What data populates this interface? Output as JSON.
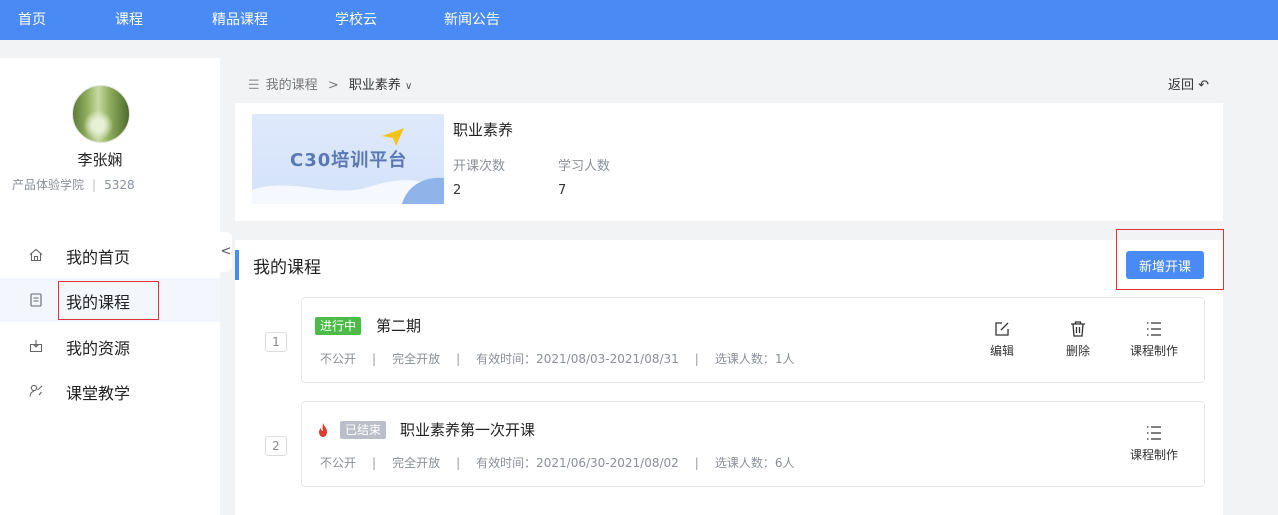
{
  "topnav": {
    "items": [
      {
        "label": "首页"
      },
      {
        "label": "课程"
      },
      {
        "label": "精品课程"
      },
      {
        "label": "学校云"
      },
      {
        "label": "新闻公告"
      }
    ]
  },
  "profile": {
    "name": "李张娴",
    "org": "产品体验学院",
    "id": "5328"
  },
  "sidebar": {
    "items": [
      {
        "label": "我的首页",
        "icon": "home-icon"
      },
      {
        "label": "我的课程",
        "icon": "course-icon",
        "active": true
      },
      {
        "label": "我的资源",
        "icon": "resource-icon"
      },
      {
        "label": "课堂教学",
        "icon": "teaching-icon"
      }
    ],
    "collapse_glyph": "<"
  },
  "breadcrumb": {
    "root": "我的课程",
    "separator": ">",
    "current": "职业素养"
  },
  "back": {
    "label": "返回"
  },
  "course": {
    "cover_text": "C30培训平台",
    "title": "职业素养",
    "sessions_label": "开课次数",
    "sessions_value": "2",
    "learners_label": "学习人数",
    "learners_value": "7"
  },
  "section": {
    "title": "我的课程",
    "new_button": "新增开课"
  },
  "sessions": [
    {
      "index": "1",
      "status": "进行中",
      "name": "第二期",
      "visibility": "不公开",
      "openness": "完全开放",
      "valid": "有效时间：2021/08/03-2021/08/31",
      "enrolled": "选课人数：1人",
      "actions": [
        {
          "label": "编辑",
          "icon": "edit-icon"
        },
        {
          "label": "删除",
          "icon": "trash-icon"
        },
        {
          "label": "课程制作",
          "icon": "list-icon"
        }
      ]
    },
    {
      "index": "2",
      "status": "已结束",
      "name": "职业素养第一次开课",
      "visibility": "不公开",
      "openness": "完全开放",
      "valid": "有效时间：2021/06/30-2021/08/02",
      "enrolled": "选课人数：6人",
      "actions": [
        {
          "label": "课程制作",
          "icon": "list-icon"
        }
      ]
    }
  ],
  "colors": {
    "primary": "#4a8af4",
    "active_badge": "#4cbb47",
    "ended_badge": "#b9bec8",
    "highlight_box": "#e1333b"
  }
}
